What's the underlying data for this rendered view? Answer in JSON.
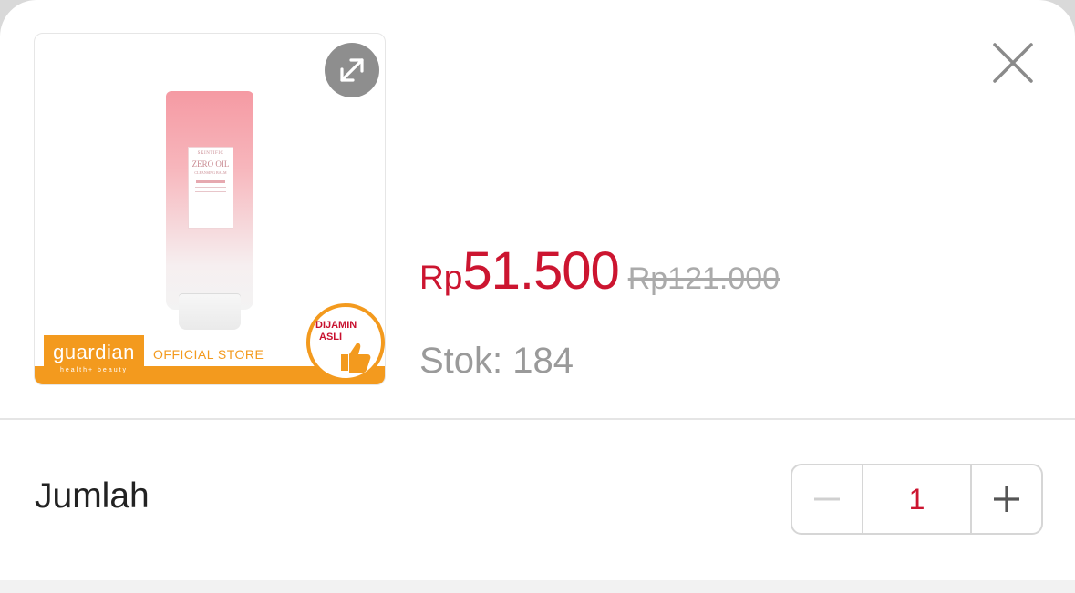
{
  "product": {
    "image_name": "Skintific Zero Oil Cleansing Balm tube",
    "tube_brand": "SKINTIFIC",
    "tube_name": "ZERO OIL",
    "tube_sub": "CLEANSING BALM",
    "brand_logo": "guardian",
    "brand_tagline": "health+ beauty",
    "store_label": "OFFICIAL STORE",
    "badge_line1": "DIJAMIN",
    "badge_line2": "ASLI"
  },
  "price": {
    "currency": "Rp",
    "current": "51.500",
    "original": "Rp121.000"
  },
  "stock_text": "Stok: 184",
  "quantity": {
    "label": "Jumlah",
    "value": "1",
    "minus_icon": "minus-icon",
    "plus_icon": "plus-icon"
  },
  "icons": {
    "expand": "expand-icon",
    "close": "close-icon"
  },
  "colors": {
    "price_red": "#cc1530",
    "brand_orange": "#f39a1e",
    "muted_gray": "#9a9a9a"
  }
}
